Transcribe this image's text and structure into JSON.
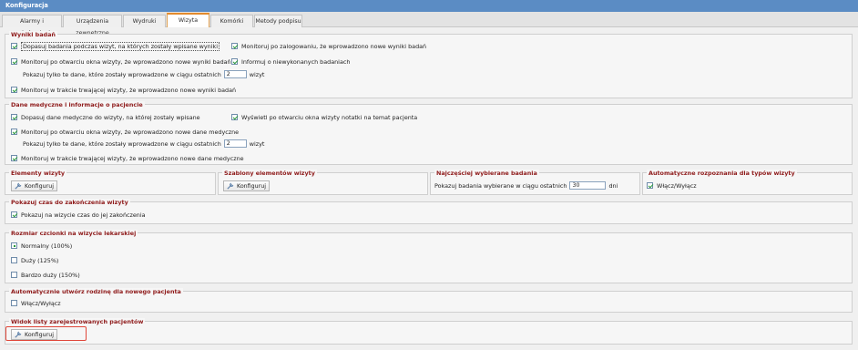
{
  "window": {
    "title": "Konfiguracja"
  },
  "tabs": [
    {
      "label": "Alarmy i powiadomienia"
    },
    {
      "label": "Urządzenia zewnętrzne"
    },
    {
      "label": "Wydruki"
    },
    {
      "label": "Wizyta"
    },
    {
      "label": "Komórki"
    },
    {
      "label": "Metody podpisu"
    }
  ],
  "wyniki": {
    "title": "Wyniki badań",
    "opt1": "Dopasuj badania podczas wizyt, na których zostały wpisane wyniki",
    "opt2": "Monitoruj po otwarciu okna wizyty, że wprowadzono nowe wyniki badań",
    "show_prefix": "Pokazuj tylko te dane, które zostały wprowadzone w ciągu ostatnich",
    "show_value": "2",
    "show_suffix": "wizyt",
    "opt3": "Monitoruj w trakcie trwającej wizyty, że wprowadzono nowe wyniki badań",
    "opt4": "Monitoruj po zalogowaniu, że wprowadzono nowe wyniki badań",
    "opt5": "Informuj o niewykonanych badaniach"
  },
  "dane": {
    "title": "Dane medyczne i informacje o pacjencie",
    "opt1": "Dopasuj dane medyczne do wizyty, na której zostały wpisane",
    "opt2": "Monitoruj po otwarciu okna wizyty, że wprowadzono nowe dane medyczne",
    "show_prefix": "Pokazuj tylko te dane, które zostały wprowadzone w ciągu ostatnich",
    "show_value": "2",
    "show_suffix": "wizyt",
    "opt3": "Monitoruj w trakcie trwającej wizyty, że wprowadzono nowe dane medyczne",
    "opt4": "Wyświetl po otwarciu okna wizyty notatki na temat pacjenta"
  },
  "elementy": {
    "title": "Elementy wizyty",
    "button": "Konfiguruj"
  },
  "szablony": {
    "title": "Szablony elementów wizyty",
    "button": "Konfiguruj"
  },
  "najczesciej": {
    "title": "Najczęściej wybierane badania",
    "prefix": "Pokazuj badania wybierane w ciągu ostatnich",
    "value": "30",
    "suffix": "dni"
  },
  "rozpoznania": {
    "title": "Automatyczne rozpoznania dla typów wizyty",
    "opt": "Włącz/Wyłącz"
  },
  "czas": {
    "title": "Pokazuj czas do zakończenia wizyty",
    "opt": "Pokazuj na wizycie czas do jej zakończenia"
  },
  "czcionka": {
    "title": "Rozmiar czcionki na wizycie lekarskiej",
    "options": [
      "Normalny (100%)",
      "Duży (125%)",
      "Bardzo duży (150%)"
    ]
  },
  "rodzina": {
    "title": "Automatycznie utwórz rodzinę dla nowego pacjenta",
    "opt": "Włącz/Wyłącz"
  },
  "widok": {
    "title": "Widok listy zarejestrowanych pacjentów",
    "button": "Konfiguruj"
  },
  "colors": {
    "title_bar": "#5b8cc4",
    "group_title": "#8e1a1a",
    "check": "#2a9a3a",
    "highlight": "#e0473a",
    "active_tab": "#e38a2c"
  }
}
